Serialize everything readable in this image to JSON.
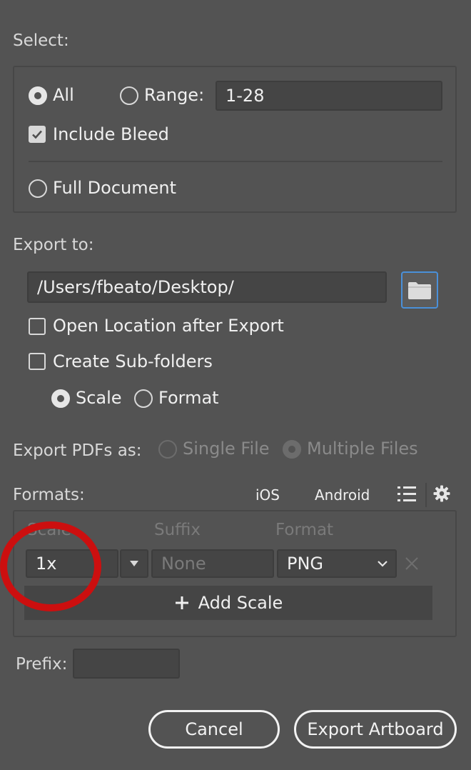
{
  "select": {
    "heading": "Select:",
    "all_label": "All",
    "range_label": "Range:",
    "range_value": "1-28",
    "include_bleed_label": "Include Bleed",
    "full_document_label": "Full Document"
  },
  "export_to": {
    "heading": "Export to:",
    "path_value": "/Users/fbeato/Desktop/",
    "open_location_label": "Open Location after Export",
    "create_subfolders_label": "Create Sub-folders",
    "scale_label": "Scale",
    "format_label": "Format"
  },
  "export_pdfs": {
    "heading": "Export PDFs as:",
    "single_file_label": "Single File",
    "multiple_files_label": "Multiple Files"
  },
  "formats": {
    "heading": "Formats:",
    "ios_label": "iOS",
    "android_label": "Android",
    "columns": {
      "scale": "Scale",
      "suffix": "Suffix",
      "format": "Format"
    },
    "row": {
      "scale": "1x",
      "suffix_placeholder": "None",
      "format": "PNG"
    },
    "add_scale_label": "Add Scale"
  },
  "prefix": {
    "label": "Prefix:",
    "value": ""
  },
  "buttons": {
    "cancel": "Cancel",
    "export_artboard": "Export Artboard"
  },
  "colors": {
    "background": "#535353",
    "focus_blue": "#4a90d9",
    "annotation_red": "#cc0f0f"
  }
}
